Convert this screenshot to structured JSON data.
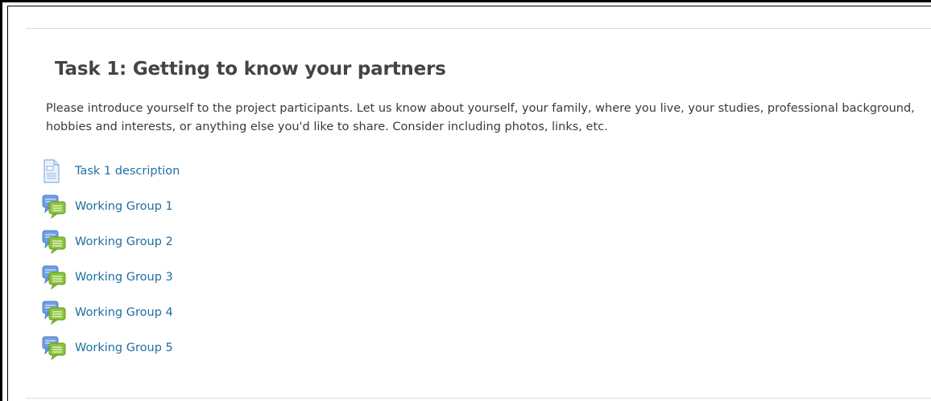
{
  "section": {
    "title": "Task 1: Getting to know your partners",
    "summary": "Please introduce yourself to the project participants. Let us know about yourself, your family, where you live, your studies, professional background, hobbies and interests, or anything else you'd like to share. Consider including photos, links, etc."
  },
  "activities": [
    {
      "label": "Task 1 description",
      "icon": "page-icon"
    },
    {
      "label": "Working Group 1",
      "icon": "forum-icon"
    },
    {
      "label": "Working Group 2",
      "icon": "forum-icon"
    },
    {
      "label": "Working Group 3",
      "icon": "forum-icon"
    },
    {
      "label": "Working Group 4",
      "icon": "forum-icon"
    },
    {
      "label": "Working Group 5",
      "icon": "forum-icon"
    }
  ],
  "colors": {
    "link": "#1f6f9f",
    "title": "#444444",
    "text": "#373a3c"
  }
}
